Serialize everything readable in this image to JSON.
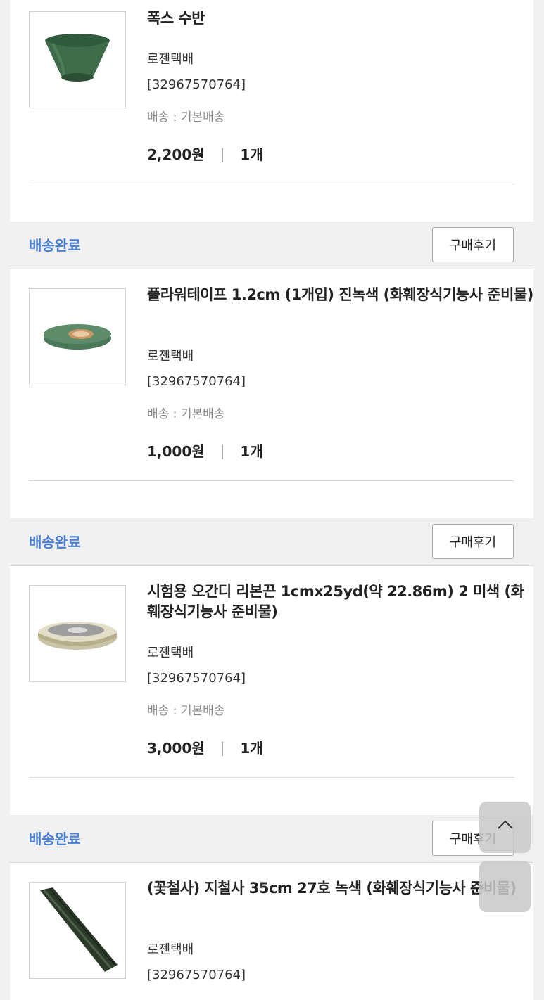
{
  "items": [
    {
      "title": "폭스 수반",
      "courier": "로젠택배",
      "code": "[32967570764]",
      "shipping": "배송 : 기본배송",
      "price": "2,200원",
      "qty": "1개",
      "image_icon": "green-vase"
    },
    {
      "title": "플라워테이프 1.2cm (1개입) 진녹색 (화훼장식기능사 준비물)",
      "courier": "로젠택배",
      "code": "[32967570764]",
      "shipping": "배송 : 기본배송",
      "price": "1,000원",
      "qty": "1개",
      "image_icon": "tape-roll"
    },
    {
      "title": "시험용 오간디 리본끈 1cmx25yd(약 22.86m) 2 미색 (화훼장식기능사 준비물)",
      "courier": "로젠택배",
      "code": "[32967570764]",
      "shipping": "배송 : 기본배송",
      "price": "3,000원",
      "qty": "1개",
      "image_icon": "ribbon-spool"
    },
    {
      "title": "(꽃철사) 지철사 35cm 27호 녹색 (화훼장식기능사 준비물)",
      "courier": "로젠택배",
      "code": "[32967570764]",
      "image_icon": "wire-bundle"
    }
  ],
  "status_bars": [
    {
      "label": "배송완료",
      "button": "구매후기"
    },
    {
      "label": "배송완료",
      "button": "구매후기"
    },
    {
      "label": "배송완료",
      "button": "구매후기"
    }
  ],
  "floating": {
    "up_icon": "chevron-up-icon"
  },
  "colors": {
    "status": "#4a7fd6",
    "background": "#f1f1f1"
  }
}
